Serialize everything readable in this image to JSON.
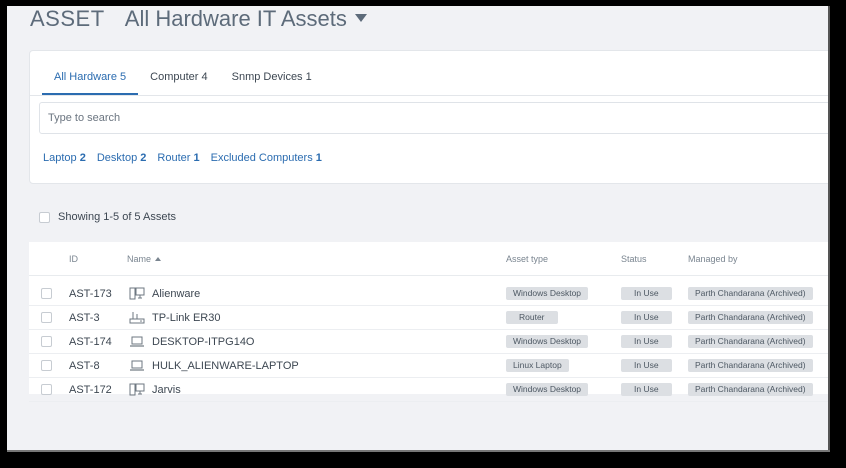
{
  "header": {
    "module": "ASSET",
    "view": "All Hardware IT Assets"
  },
  "tabs": [
    {
      "label": "All Hardware",
      "count": "5"
    },
    {
      "label": "Computer",
      "count": "4"
    },
    {
      "label": "Snmp Devices",
      "count": "1"
    }
  ],
  "search": {
    "placeholder": "Type to search"
  },
  "filters": [
    {
      "label": "Laptop",
      "count": "2"
    },
    {
      "label": "Desktop",
      "count": "2"
    },
    {
      "label": "Router",
      "count": "1"
    },
    {
      "label": "Excluded Computers",
      "count": "1"
    }
  ],
  "summary": {
    "text": "Showing 1-5 of 5 Assets"
  },
  "table": {
    "headers": {
      "id": "ID",
      "name": "Name",
      "asset_type": "Asset type",
      "status": "Status",
      "managed_by": "Managed by"
    },
    "rows": [
      {
        "id": "AST-173",
        "icon": "desktop-icon",
        "name": "Alienware",
        "asset_type": "Windows Desktop",
        "status": "In Use",
        "managed_by": "Parth Chandarana (Archived)"
      },
      {
        "id": "AST-3",
        "icon": "router-icon",
        "name": "TP-Link ER30",
        "asset_type": "Router",
        "status": "In Use",
        "managed_by": "Parth Chandarana (Archived)"
      },
      {
        "id": "AST-174",
        "icon": "laptop-icon",
        "name": "DESKTOP-ITPG14O",
        "asset_type": "Windows Desktop",
        "status": "In Use",
        "managed_by": "Parth Chandarana (Archived)"
      },
      {
        "id": "AST-8",
        "icon": "laptop-icon",
        "name": "HULK_ALIENWARE-LAPTOP",
        "asset_type": "Linux Laptop",
        "status": "In Use",
        "managed_by": "Parth Chandarana (Archived)"
      },
      {
        "id": "AST-172",
        "icon": "desktop-icon",
        "name": "Jarvis",
        "asset_type": "Windows Desktop",
        "status": "In Use",
        "managed_by": "Parth Chandarana (Archived)"
      }
    ]
  }
}
